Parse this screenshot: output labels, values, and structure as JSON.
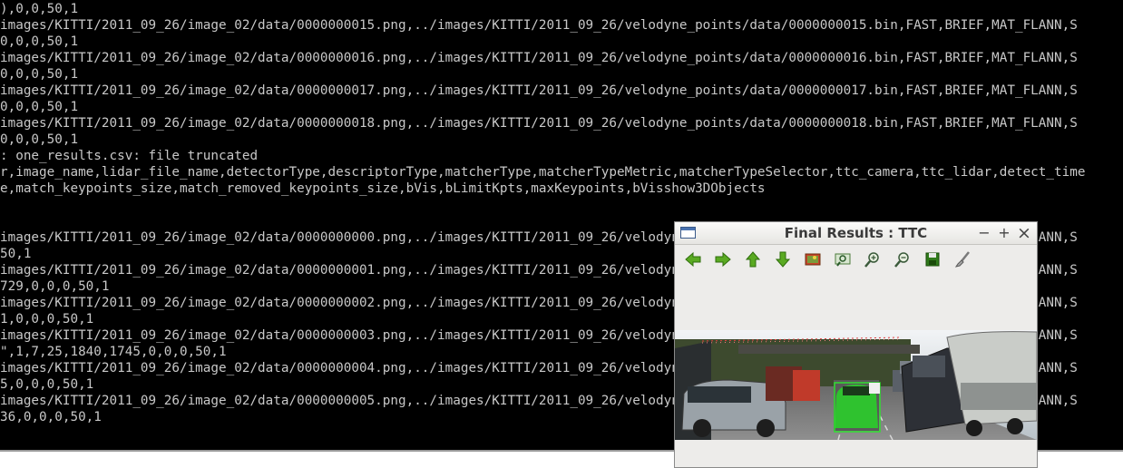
{
  "terminal": {
    "lines": [
      "),0,0,50,1",
      "images/KITTI/2011_09_26/image_02/data/0000000015.png,../images/KITTI/2011_09_26/velodyne_points/data/0000000015.bin,FAST,BRIEF,MAT_FLANN,S",
      "0,0,0,50,1",
      "images/KITTI/2011_09_26/image_02/data/0000000016.png,../images/KITTI/2011_09_26/velodyne_points/data/0000000016.bin,FAST,BRIEF,MAT_FLANN,S",
      "0,0,0,50,1",
      "images/KITTI/2011_09_26/image_02/data/0000000017.png,../images/KITTI/2011_09_26/velodyne_points/data/0000000017.bin,FAST,BRIEF,MAT_FLANN,S",
      "0,0,0,50,1",
      "images/KITTI/2011_09_26/image_02/data/0000000018.png,../images/KITTI/2011_09_26/velodyne_points/data/0000000018.bin,FAST,BRIEF,MAT_FLANN,S",
      "0,0,0,50,1",
      ": one_results.csv: file truncated",
      "r,image_name,lidar_file_name,detectorType,descriptorType,matcherType,matcherTypeMetric,matcherTypeSelector,ttc_camera,ttc_lidar,detect_time",
      "e,match_keypoints_size,match_removed_keypoints_size,bVis,bLimitKpts,maxKeypoints,bVisshow3DObjects",
      "",
      "",
      "images/KITTI/2011_09_26/image_02/data/0000000000.png,../images/KITTI/2011_09_26/velodyne_points/data/0000000000.bin,FAST,BRIEF,MAT_FLANN,S",
      "50,1",
      "images/KITTI/2011_09_26/image_02/data/0000000001.png,../images/KITTI/2011_09_26/velodyne_points/data/0000000001.bin,FAST,BRIEF,MAT_FLANN,S",
      "729,0,0,0,50,1",
      "images/KITTI/2011_09_26/image_02/data/0000000002.png,../images/KITTI/2011_09_26/velodyne_points/data/0000000002.bin,FAST,BRIEF,MAT_FLANN,S",
      "1,0,0,0,50,1",
      "images/KITTI/2011_09_26/image_02/data/0000000003.png,../images/KITTI/2011_09_26/velodyne_points/data/0000000003.bin,FAST,BRIEF,MAT_FLANN,S",
      "\",1,7,25,1840,1745,0,0,0,50,1",
      "images/KITTI/2011_09_26/image_02/data/0000000004.png,../images/KITTI/2011_09_26/velodyne_points/data/0000000004.bin,FAST,BRIEF,MAT_FLANN,S",
      "5,0,0,0,50,1",
      "images/KITTI/2011_09_26/image_02/data/0000000005.png,../images/KITTI/2011_09_26/velodyne_points/data/0000000005.bin,FAST,BRIEF,MAT_FLANN,S",
      "36,0,0,0,50,1"
    ]
  },
  "window": {
    "title": "Final Results : TTC",
    "minimize_glyph": "−",
    "maximize_glyph": "+",
    "close_glyph": "×",
    "toolbar_icons": [
      "arrow-left-icon",
      "arrow-right-icon",
      "arrow-up-icon",
      "arrow-down-icon",
      "image-icon",
      "zoom-to-fit-icon",
      "zoom-in-icon",
      "zoom-out-icon",
      "save-icon",
      "properties-brush-icon"
    ]
  },
  "colors": {
    "terminal_bg": "#000000",
    "terminal_fg": "#c8c8c8",
    "icon_green": "#4a9a1a",
    "bbox_green": "#2fe02f"
  }
}
